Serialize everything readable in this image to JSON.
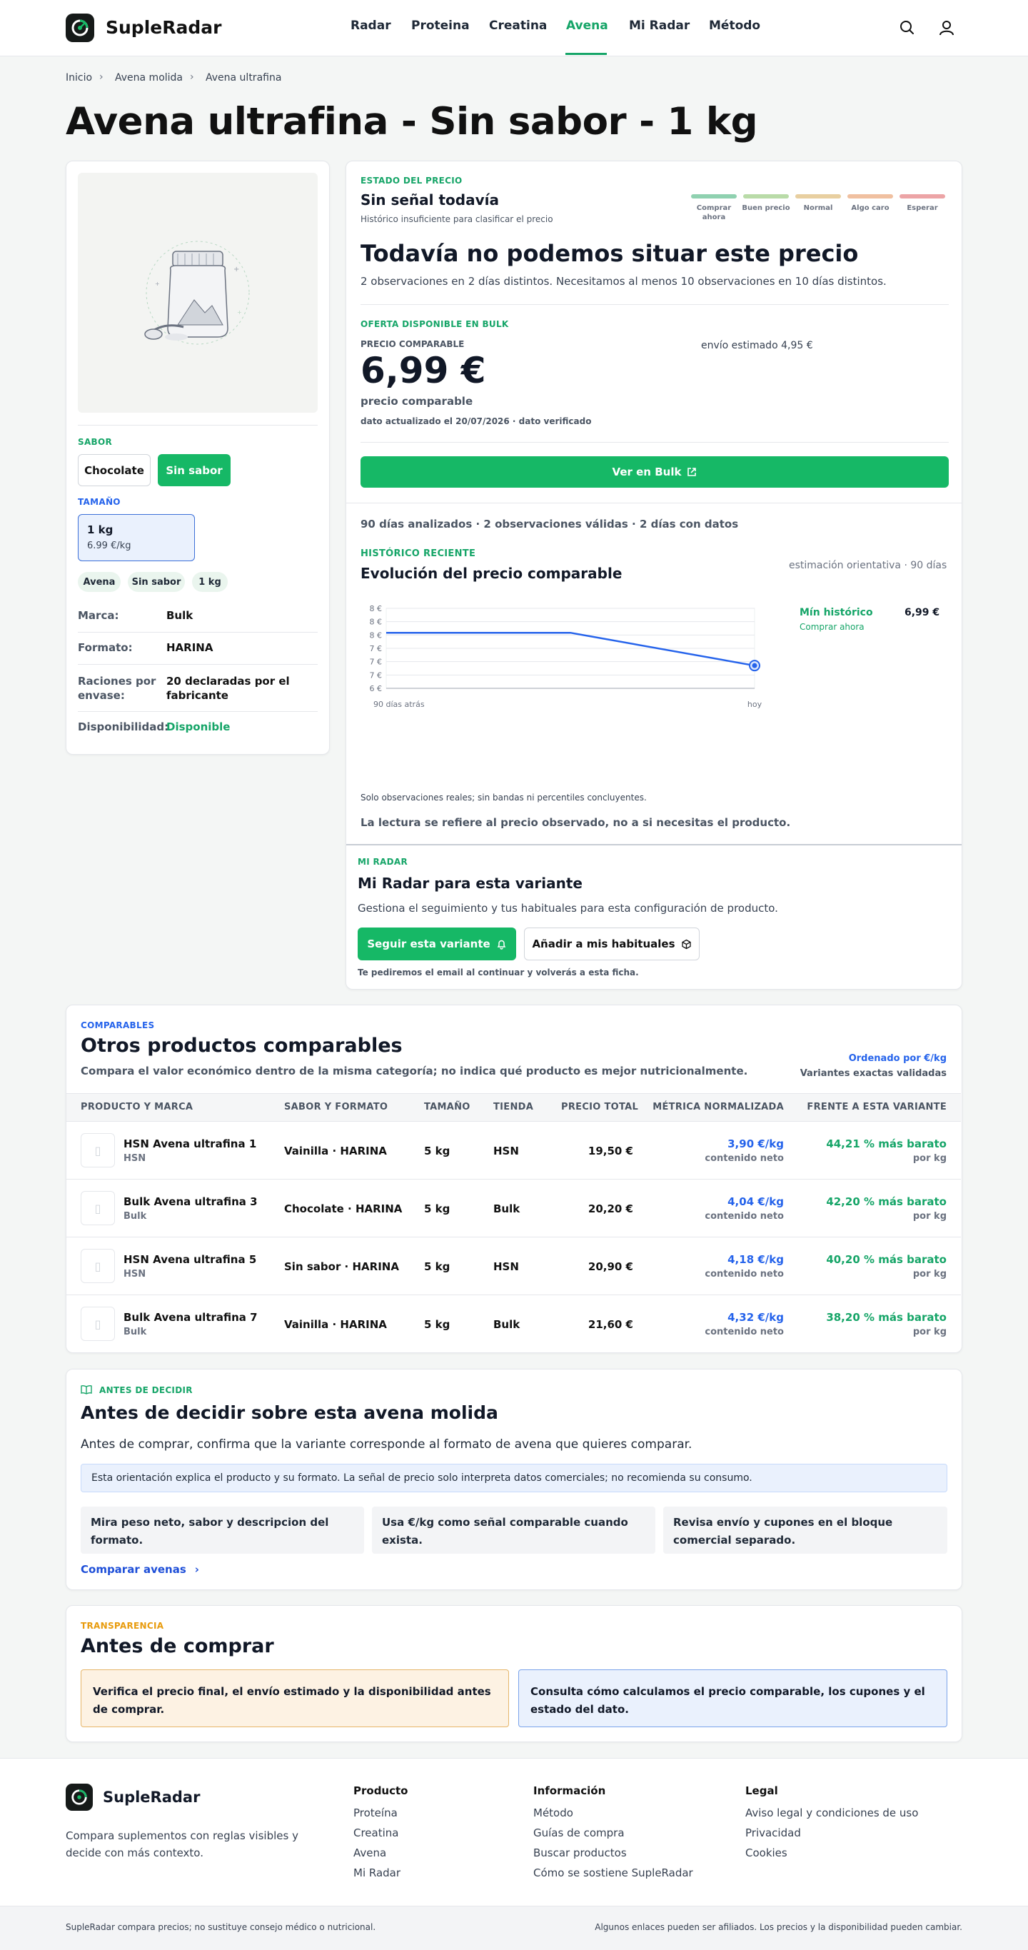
{
  "header": {
    "brand": "SupleRadar",
    "nav": [
      "Radar",
      "Proteina",
      "Creatina",
      "Avena",
      "Mi Radar",
      "Método"
    ],
    "active_nav": "Avena"
  },
  "breadcrumb": [
    "Inicio",
    "Avena molida",
    "Avena ultrafina"
  ],
  "product": {
    "title": "Avena ultrafina - Sin sabor - 1 kg",
    "flavor_label": "SABOR",
    "flavors": [
      "Chocolate",
      "Sin sabor"
    ],
    "selected_flavor": "Sin sabor",
    "size_label": "TAMAÑO",
    "size": {
      "name": "1 kg",
      "price_per": "6.99 €/kg"
    },
    "tags": [
      "Avena",
      "Sin sabor",
      "1 kg"
    ],
    "specs": [
      {
        "label": "Marca:",
        "value": "Bulk"
      },
      {
        "label": "Formato:",
        "value": "HARINA"
      },
      {
        "label": "Raciones por envase:",
        "value": "20 declaradas por el fabricante"
      },
      {
        "label": "Disponibilidad:",
        "value": "Disponible"
      }
    ]
  },
  "price_state": {
    "kicker": "ESTADO DEL PRECIO",
    "heading": "Sin señal todavía",
    "sub": "Histórico insuficiente para clasificar el precio",
    "scale": [
      {
        "label": "Comprar ahora",
        "color": "#8fd1b0"
      },
      {
        "label": "Buen precio",
        "color": "#b9dba8"
      },
      {
        "label": "Normal",
        "color": "#e8cfa0"
      },
      {
        "label": "Algo caro",
        "color": "#f0c0a0"
      },
      {
        "label": "Esperar",
        "color": "#eca4a6"
      }
    ],
    "big_heading": "Todavía no podemos situar este precio",
    "description": "2 observaciones en 2 días distintos. Necesitamos al menos 10 observaciones en 10 días distintos.",
    "offer_kicker": "OFERTA DISPONIBLE EN BULK",
    "comparable_label": "PRECIO COMPARABLE",
    "price": "6,99 €",
    "price_caption": "precio comparable",
    "updated": "dato actualizado el 20/07/2026 · dato verificado",
    "shipping": "envío estimado 4,95 €",
    "cta": "Ver en Bulk"
  },
  "history": {
    "summary": "90 días analizados · 2 observaciones válidas · 2 días con datos",
    "kicker": "HISTÓRICO RECIENTE",
    "heading": "Evolución del precio comparable",
    "estimate_note": "estimación orientativa · 90 días",
    "min_label": "Mín histórico",
    "min_value": "6,99 €",
    "min_sub": "Comprar ahora",
    "note1": "Solo observaciones reales; sin bandas ni percentiles concluyentes.",
    "note2": "La lectura se refiere al precio observado, no a si necesitas el producto."
  },
  "chart_data": {
    "type": "line",
    "x": [
      "90 días atrás",
      "",
      "hoy"
    ],
    "y_ticks": [
      "8 €",
      "8 €",
      "8 €",
      "7 €",
      "7 €",
      "7 €",
      "6 €"
    ],
    "series": [
      {
        "values": [
          7.77,
          7.77,
          6.99
        ]
      }
    ],
    "x_positions": [
      0,
      0.5,
      1
    ],
    "ylim": [
      6.45,
      8.35
    ],
    "grid": true,
    "color": "#2563eb"
  },
  "my_radar": {
    "kicker": "MI RADAR",
    "heading": "Mi Radar para esta variante",
    "description": "Gestiona el seguimiento y tus habituales para esta configuración de producto.",
    "follow": "Seguir esta variante",
    "add": "Añadir a mis habituales",
    "note": "Te pediremos el email al continuar y volverás a esta ficha."
  },
  "comparables": {
    "kicker": "COMPARABLES",
    "heading": "Otros productos comparables",
    "description": "Compara el valor económico dentro de la misma categoría; no indica qué producto es mejor nutricionalmente.",
    "sort": "Ordenado por €/kg",
    "validated": "Variantes exactas validadas",
    "columns": [
      "PRODUCTO Y MARCA",
      "SABOR Y FORMATO",
      "TAMAÑO",
      "TIENDA",
      "PRECIO TOTAL",
      "MÉTRICA NORMALIZADA",
      "FRENTE A ESTA VARIANTE"
    ],
    "rows": [
      {
        "name": "HSN Avena ultrafina 1",
        "brand": "HSN",
        "flavor": "Vainilla · HARINA",
        "size": "5 kg",
        "store": "HSN",
        "price": "19,50 €",
        "metric": "3,90 €/kg",
        "metric_sub": "contenido neto",
        "diff": "44,21 % más barato",
        "diff_sub": "por kg"
      },
      {
        "name": "Bulk Avena ultrafina 3",
        "brand": "Bulk",
        "flavor": "Chocolate · HARINA",
        "size": "5 kg",
        "store": "Bulk",
        "price": "20,20 €",
        "metric": "4,04 €/kg",
        "metric_sub": "contenido neto",
        "diff": "42,20 % más barato",
        "diff_sub": "por kg"
      },
      {
        "name": "HSN Avena ultrafina 5",
        "brand": "HSN",
        "flavor": "Sin sabor · HARINA",
        "size": "5 kg",
        "store": "HSN",
        "price": "20,90 €",
        "metric": "4,18 €/kg",
        "metric_sub": "contenido neto",
        "diff": "40,20 % más barato",
        "diff_sub": "por kg"
      },
      {
        "name": "Bulk Avena ultrafina 7",
        "brand": "Bulk",
        "flavor": "Vainilla · HARINA",
        "size": "5 kg",
        "store": "Bulk",
        "price": "21,60 €",
        "metric": "4,32 €/kg",
        "metric_sub": "contenido neto",
        "diff": "38,20 % más barato",
        "diff_sub": "por kg"
      }
    ]
  },
  "decide": {
    "kicker": "ANTES DE DECIDIR",
    "heading": "Antes de decidir sobre esta avena molida",
    "description": "Antes de comprar, confirma que la variante corresponde al formato de avena que quieres comparar.",
    "info": "Esta orientación explica el producto y su formato. La señal de precio solo interpreta datos comerciales; no recomienda su consumo.",
    "tips": [
      "Mira peso neto, sabor y descripcion del formato.",
      "Usa €/kg como señal comparable cuando exista.",
      "Revisa envío y cupones en el bloque comercial separado."
    ],
    "link": "Comparar avenas"
  },
  "transparency": {
    "kicker": "TRANSPARENCIA",
    "heading": "Antes de comprar",
    "warn": "Verifica el precio final, el envío estimado y la disponibilidad antes de comprar.",
    "info": "Consulta cómo calculamos el precio comparable, los cupones y el estado del dato."
  },
  "footer": {
    "brand": "SupleRadar",
    "tagline": "Compara suplementos con reglas visibles y decide con más contexto.",
    "cols": [
      {
        "title": "Producto",
        "links": [
          "Proteína",
          "Creatina",
          "Avena",
          "Mi Radar"
        ]
      },
      {
        "title": "Información",
        "links": [
          "Método",
          "Guías de compra",
          "Buscar productos",
          "Cómo se sostiene SupleRadar"
        ]
      },
      {
        "title": "Legal",
        "links": [
          "Aviso legal y condiciones de uso",
          "Privacidad",
          "Cookies"
        ]
      }
    ],
    "bottom_left": "SupleRadar compara precios; no sustituye consejo médico o nutricional.",
    "bottom_right": "Algunos enlaces pueden ser afiliados. Los precios y la disponibilidad pueden cambiar."
  }
}
